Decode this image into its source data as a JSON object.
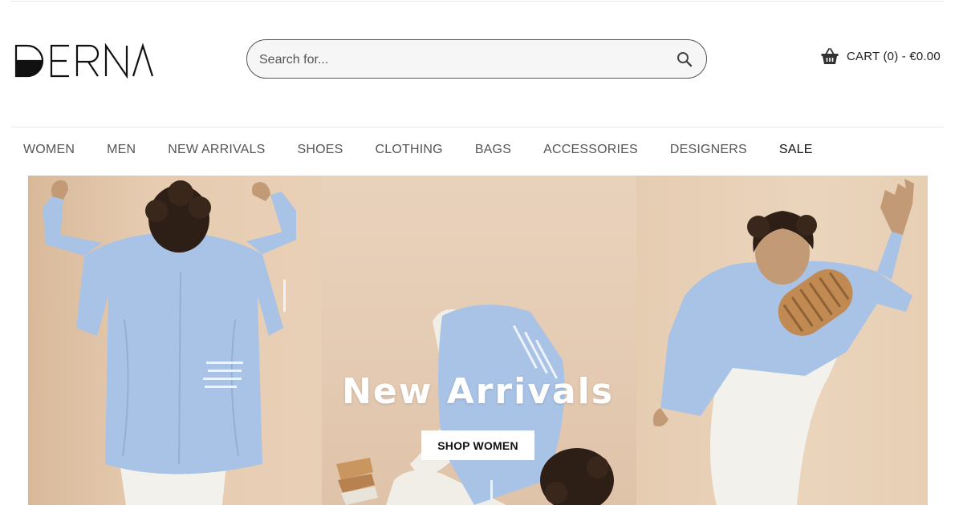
{
  "brand": {
    "logo_text": "DERNA"
  },
  "search": {
    "placeholder": "Search for..."
  },
  "cart": {
    "label": "CART (0) - €0.00"
  },
  "nav": {
    "items": [
      {
        "label": "WOMEN"
      },
      {
        "label": "MEN"
      },
      {
        "label": "NEW ARRIVALS"
      },
      {
        "label": "SHOES"
      },
      {
        "label": "CLOTHING"
      },
      {
        "label": "BAGS"
      },
      {
        "label": "ACCESSORIES"
      },
      {
        "label": "DESIGNERS"
      },
      {
        "label": "SALE"
      }
    ]
  },
  "hero": {
    "title": "New Arrivals",
    "cta_label": "SHOP WOMEN"
  },
  "icons": {
    "search": "search-icon",
    "cart": "basket-icon"
  },
  "colors": {
    "text": "#222222",
    "nav_text": "#555555",
    "hero_background": "#ead7c2",
    "cta_background": "#ffffff"
  }
}
